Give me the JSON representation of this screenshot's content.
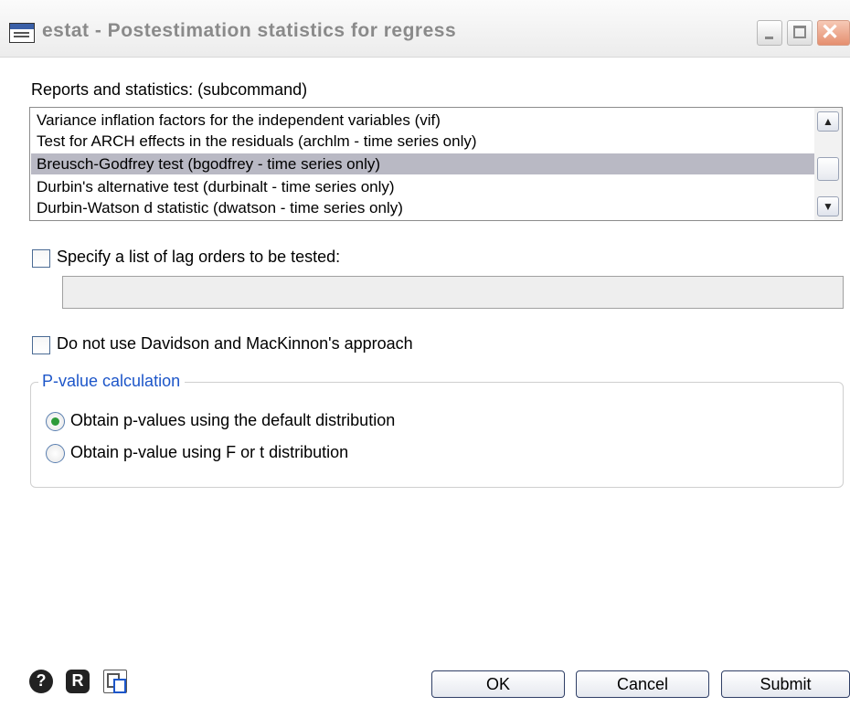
{
  "window": {
    "title": "estat - Postestimation statistics for regress"
  },
  "reports": {
    "label": "Reports and statistics: (subcommand)",
    "items": [
      "Variance inflation factors for the independent variables (vif)",
      "Test for ARCH effects in the residuals (archlm - time series only)",
      "Breusch-Godfrey test (bgodfrey - time series only)",
      "Durbin's alternative test (durbinalt - time series only)",
      "Durbin-Watson d statistic (dwatson - time series only)"
    ],
    "selected_index": 2
  },
  "lag_orders": {
    "checkbox_label": "Specify a list of lag orders to be tested:",
    "checked": false,
    "value": ""
  },
  "davidson": {
    "checkbox_label": "Do not use Davidson and MacKinnon's approach",
    "checked": false
  },
  "pvalue": {
    "group_label": "P-value calculation",
    "options": [
      "Obtain p-values using the default distribution",
      "Obtain p-value using F or t distribution"
    ],
    "selected_index": 0
  },
  "toolbar": {
    "icons": [
      "help-icon",
      "rerun-icon",
      "copy-icon"
    ],
    "ok_label": "OK",
    "cancel_label": "Cancel",
    "submit_label": "Submit"
  },
  "colors": {
    "selection": "#b9b9c4",
    "group_label": "#1d56c9",
    "radio_dot": "#2e9b3a"
  }
}
